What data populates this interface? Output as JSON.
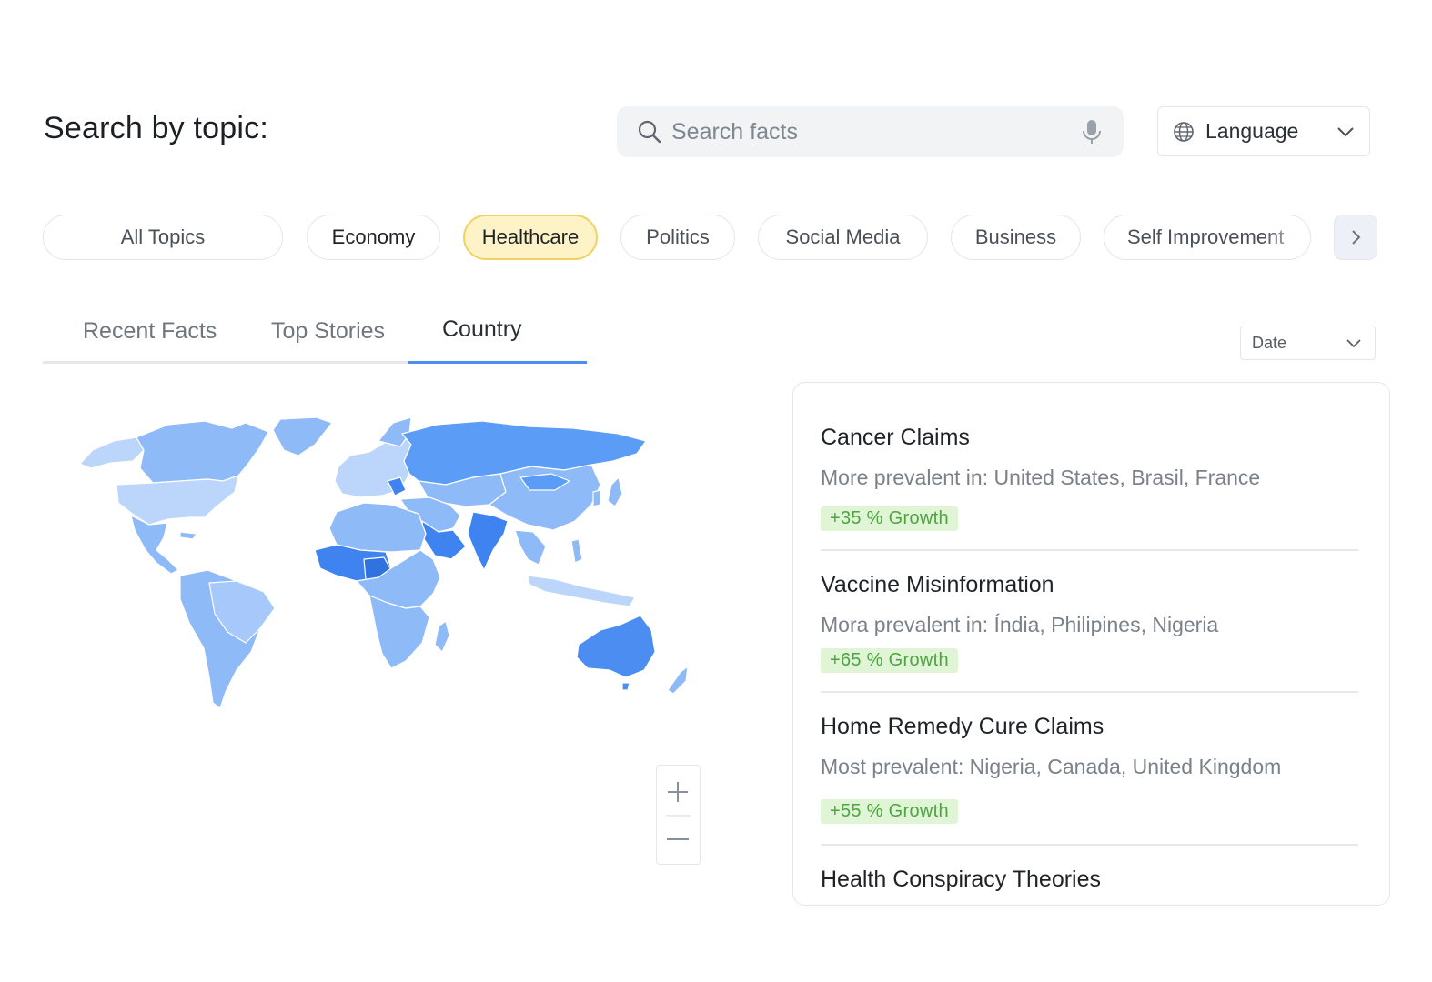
{
  "header": {
    "title": "Search by topic:",
    "search_placeholder": "Search facts",
    "language_label": "Language"
  },
  "topics": [
    {
      "label": "All Topics",
      "active": false
    },
    {
      "label": "Economy",
      "active": false
    },
    {
      "label": "Healthcare",
      "active": true
    },
    {
      "label": "Politics",
      "active": false
    },
    {
      "label": "Social Media",
      "active": false
    },
    {
      "label": "Business",
      "active": false
    },
    {
      "label": "Self Improvement",
      "active": false
    }
  ],
  "tabs": [
    {
      "label": "Recent Facts",
      "active": false
    },
    {
      "label": "Top Stories",
      "active": false
    },
    {
      "label": "Country",
      "active": true
    }
  ],
  "sort": {
    "label": "Date"
  },
  "colors": {
    "accent": "#4b8df0",
    "active_chip_bg": "#fdf3c6",
    "active_chip_border": "#f0d263",
    "growth_bg": "#dff5d6",
    "growth_text": "#4fa343",
    "map_light": "#bcd6fb",
    "map_medium": "#8fbaf8",
    "map_strong": "#5b9cf6",
    "map_dark": "#3e83ef"
  },
  "facts": [
    {
      "title": "Cancer Claims",
      "description": "More prevalent in: United States, Brasil, France",
      "growth": "+35 % Growth"
    },
    {
      "title": "Vaccine Misinformation",
      "description": "Mora prevalent in: Índia, Philipines, Nigeria",
      "growth": "+65 % Growth"
    },
    {
      "title": "Home Remedy Cure Claims",
      "description": "Most prevalent: Nigeria, Canada, United Kingdom",
      "growth": "+55 % Growth"
    },
    {
      "title": "Health Conspiracy Theories"
    }
  ],
  "icons": {
    "search": "search-icon",
    "mic": "microphone-icon",
    "globe": "globe-icon",
    "chevron": "chevron-down-icon",
    "next": "chevron-right-icon",
    "zoom_in": "plus-icon",
    "zoom_out": "minus-icon"
  }
}
